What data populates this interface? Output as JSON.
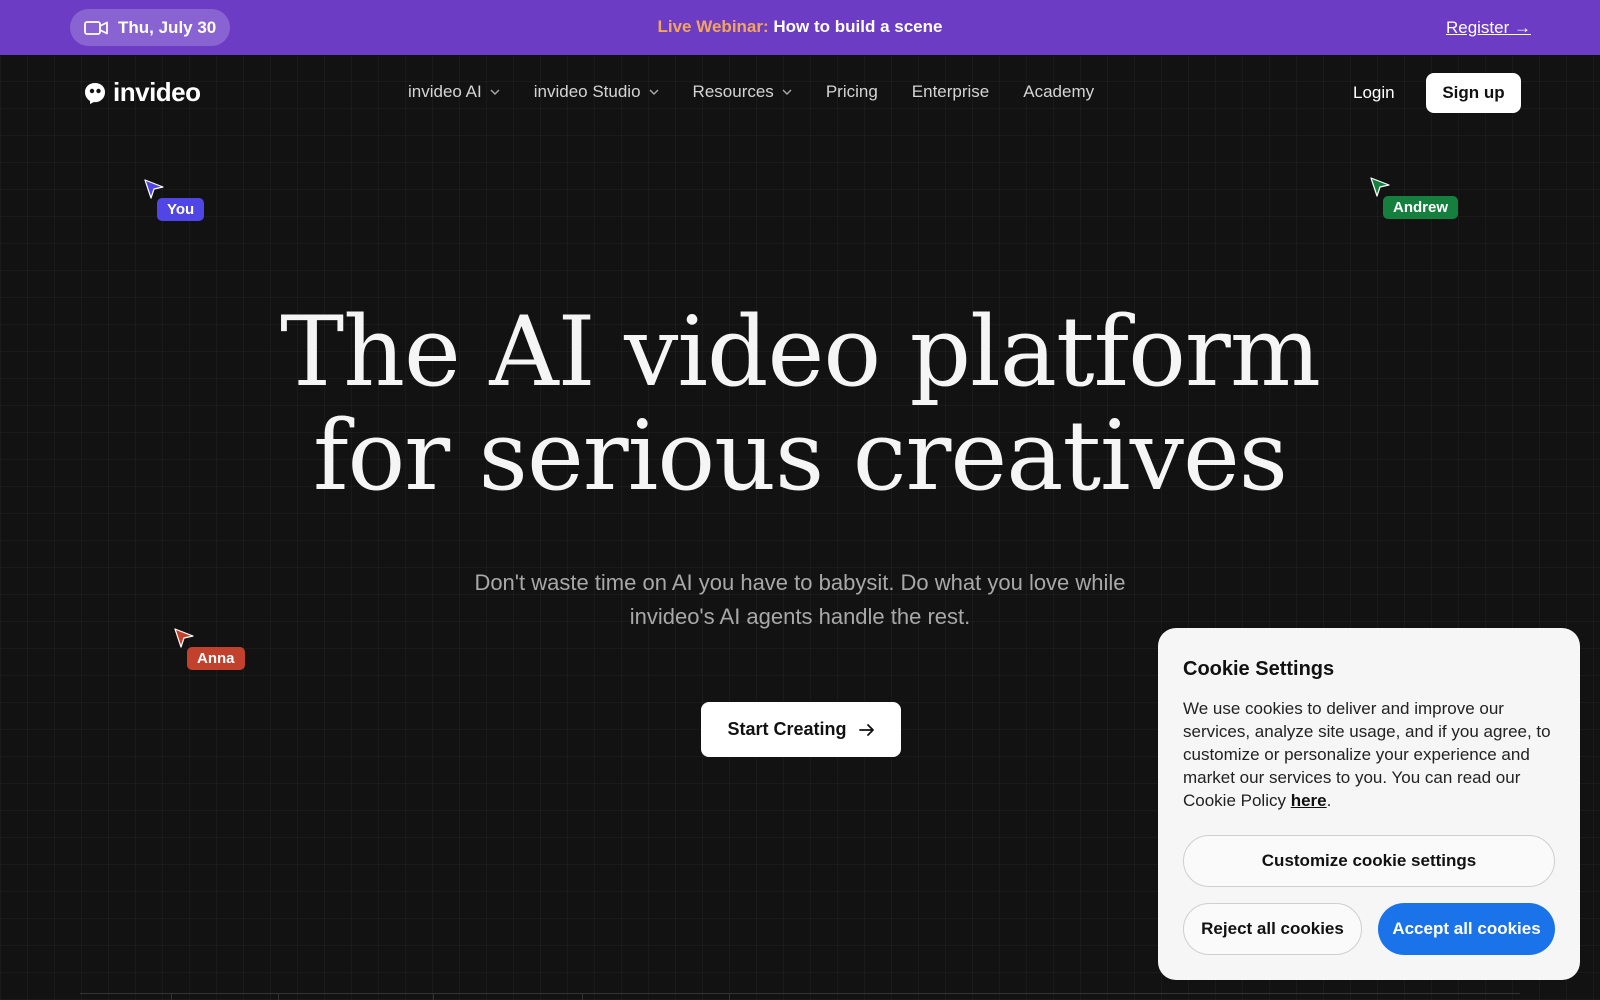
{
  "banner": {
    "date": "Thu, July 30",
    "webinar_label": "Live Webinar:",
    "webinar_title": "How to build a scene",
    "register": "Register →",
    "bg_color": "#6d3cc4",
    "label_color": "#f2a65c"
  },
  "nav": {
    "logo_text": "invideo",
    "items": [
      {
        "label": "invideo AI",
        "has_dropdown": true
      },
      {
        "label": "invideo Studio",
        "has_dropdown": true
      },
      {
        "label": "Resources",
        "has_dropdown": true
      },
      {
        "label": "Pricing",
        "has_dropdown": false
      },
      {
        "label": "Enterprise",
        "has_dropdown": false
      },
      {
        "label": "Academy",
        "has_dropdown": false
      }
    ],
    "login": "Login",
    "signup": "Sign up"
  },
  "cursors": [
    {
      "name": "You",
      "color": "#4f46e5"
    },
    {
      "name": "Andrew",
      "color": "#15803d"
    },
    {
      "name": "Anna",
      "color": "#c2412d"
    }
  ],
  "hero": {
    "title_line1": "The AI video platform",
    "title_line2": "for serious creatives",
    "subtitle": "Don't waste time on AI you have to babysit. Do what you love while invideo's AI agents handle the rest.",
    "cta": "Start Creating"
  },
  "cookie": {
    "title": "Cookie Settings",
    "body": "We use cookies to deliver and improve our services, analyze site usage, and if you agree, to customize or personalize your experience and market our services to you. You can read our Cookie Policy ",
    "link": "here",
    "body_end": ".",
    "customize": "Customize cookie settings",
    "reject": "Reject all cookies",
    "accept": "Accept all cookies",
    "accept_color": "#1a73e8"
  },
  "icons": {
    "date": "video-camera-icon",
    "logo": "invideo-logo-icon",
    "dropdown": "chevron-down-icon",
    "cta": "arrow-right-icon",
    "cursor": "pointer-arrow-icon"
  }
}
